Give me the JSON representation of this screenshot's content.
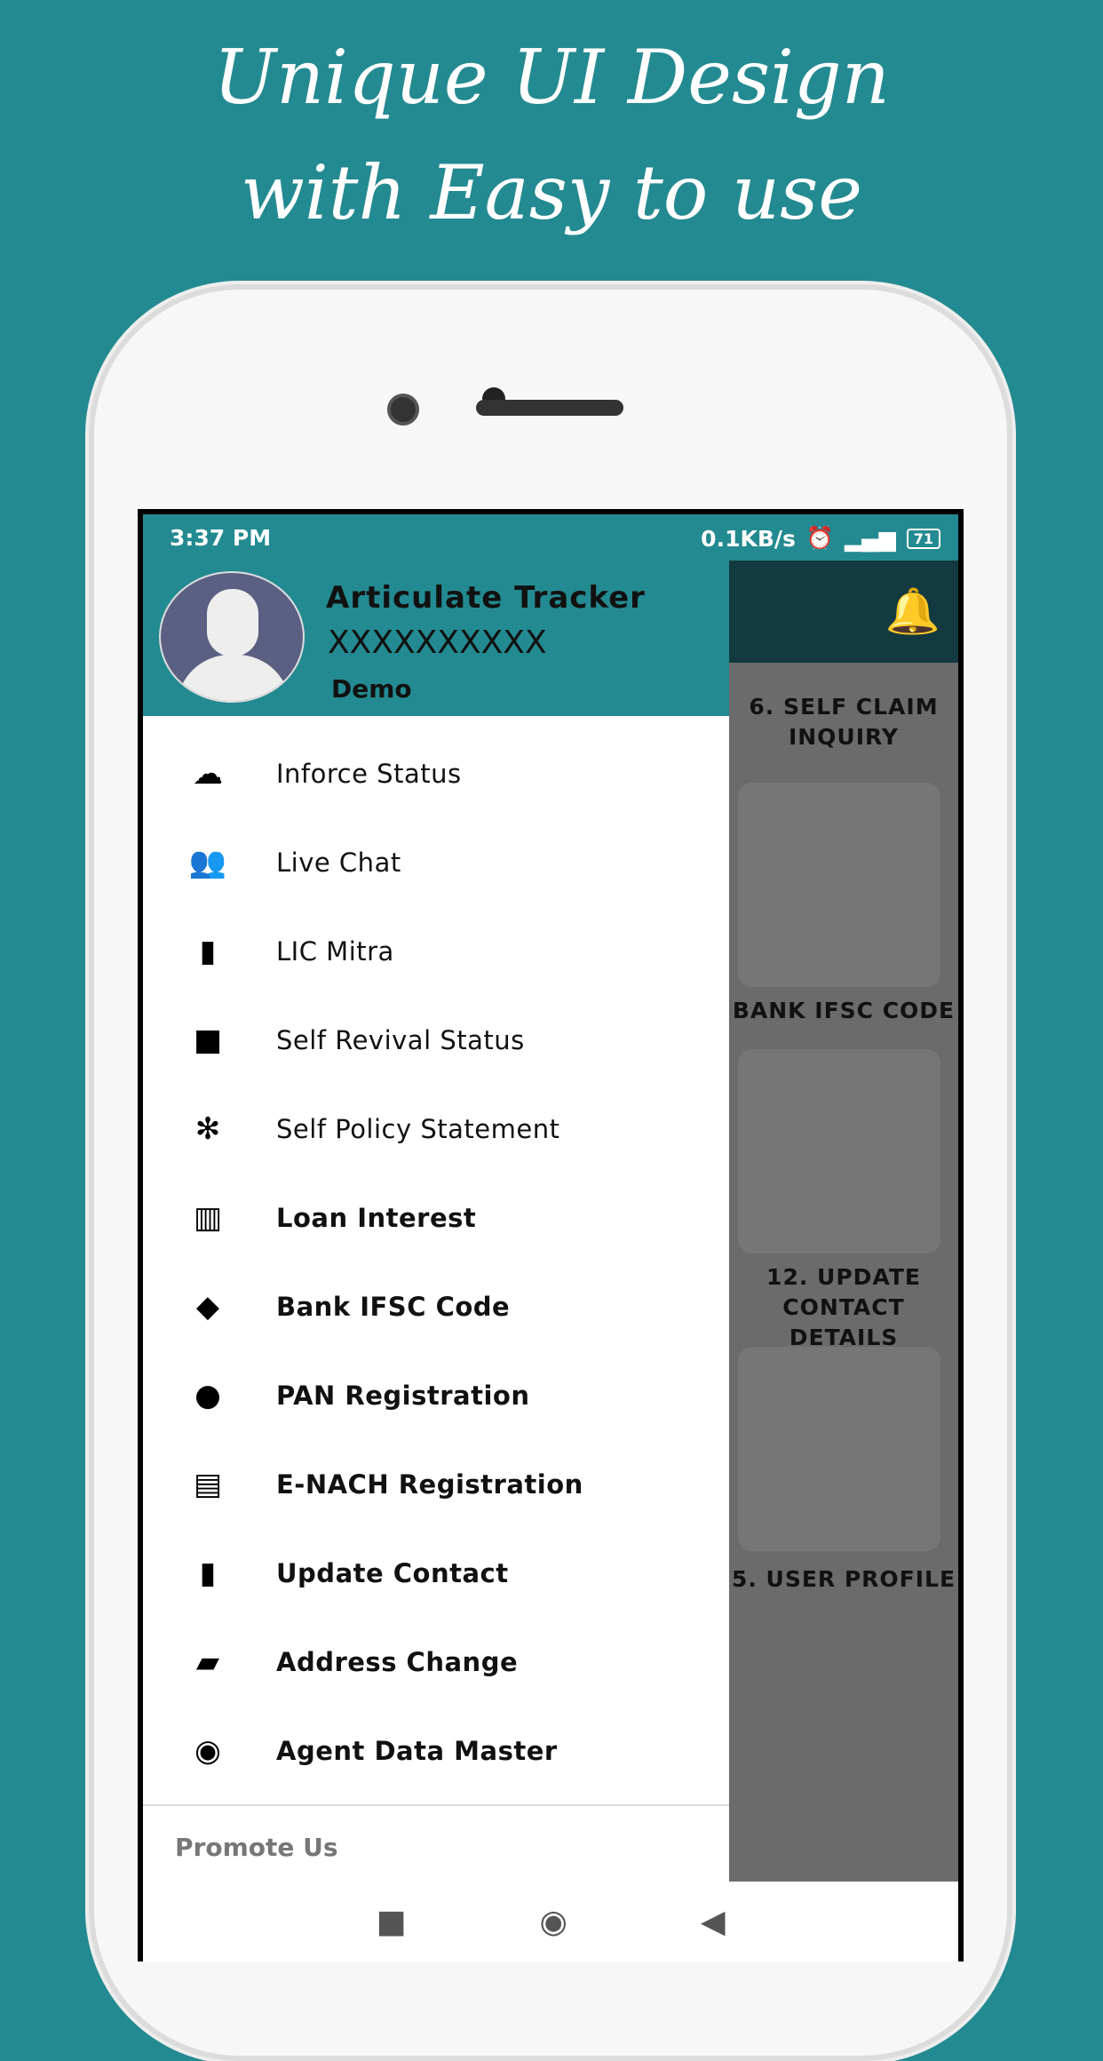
{
  "headline": {
    "line1": "Unique UI Design",
    "line2": "with Easy to use"
  },
  "status_bar": {
    "time": "3:37 PM",
    "speed": "0.1KB/s",
    "battery": "71"
  },
  "drawer": {
    "user_name": "Articulate Tracker",
    "user_number": "XXXXXXXXXX",
    "user_role": "Demo",
    "items": [
      {
        "label": "Inforce Status",
        "icon": "cloud-download-icon"
      },
      {
        "label": "Live Chat",
        "icon": "chat-people-icon"
      },
      {
        "label": "LIC Mitra",
        "icon": "folder-person-icon"
      },
      {
        "label": "Self Revival Status",
        "icon": "document-icon"
      },
      {
        "label": "Self Policy Statement",
        "icon": "ideas-icon"
      },
      {
        "label": "Loan Interest",
        "icon": "chart-icon"
      },
      {
        "label": "Bank IFSC Code",
        "icon": "card-icon"
      },
      {
        "label": "PAN Registration",
        "icon": "pan-icon"
      },
      {
        "label": "E-NACH Registration",
        "icon": "film-icon"
      },
      {
        "label": "Update Contact",
        "icon": "person-board-icon"
      },
      {
        "label": "Address Change",
        "icon": "laptop-icon"
      },
      {
        "label": "Agent Data Master",
        "icon": "search-icon"
      }
    ],
    "section": "Promote Us"
  },
  "background_tiles": [
    "6. SELF CLAIM INQUIRY",
    "BANK IFSC CODE",
    "12. UPDATE CONTACT DETAILS",
    "5. USER PROFILE"
  ],
  "colors": {
    "teal": "#248a91",
    "drawer": "#ffffff"
  }
}
